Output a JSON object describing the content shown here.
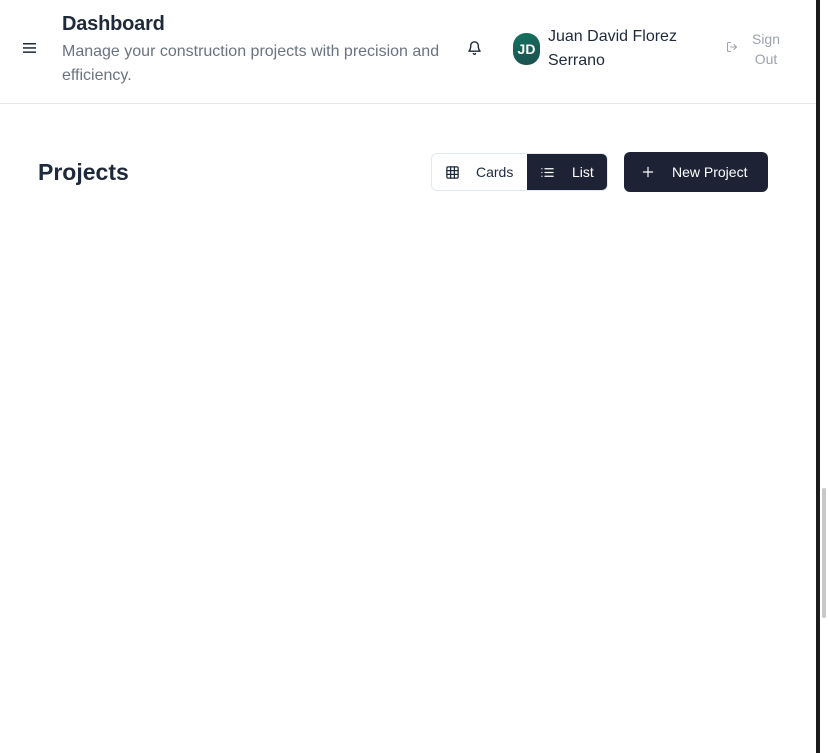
{
  "header": {
    "title": "Dashboard",
    "subtitle": "Manage your construction projects with precision and efficiency.",
    "menu_icon": "hamburger-menu-icon",
    "notification_icon": "bell-icon",
    "user": {
      "initials": "JD",
      "name": "Juan David Florez Serrano"
    },
    "sign_out": {
      "label": "Sign Out",
      "icon": "sign-out-icon"
    }
  },
  "main": {
    "section_title": "Projects",
    "view_toggle": {
      "options": [
        {
          "label": "Cards",
          "icon": "grid-icon",
          "active": false
        },
        {
          "label": "List",
          "icon": "list-icon",
          "active": true
        }
      ]
    },
    "new_project_button": {
      "label": "New Project",
      "icon": "plus-icon"
    }
  },
  "colors": {
    "primary_dark": "#1e2235",
    "avatar_gradient_start": "#11755f",
    "avatar_gradient_end": "#1d4d4f",
    "muted_text": "#6b7280",
    "border": "#e5e7eb"
  }
}
